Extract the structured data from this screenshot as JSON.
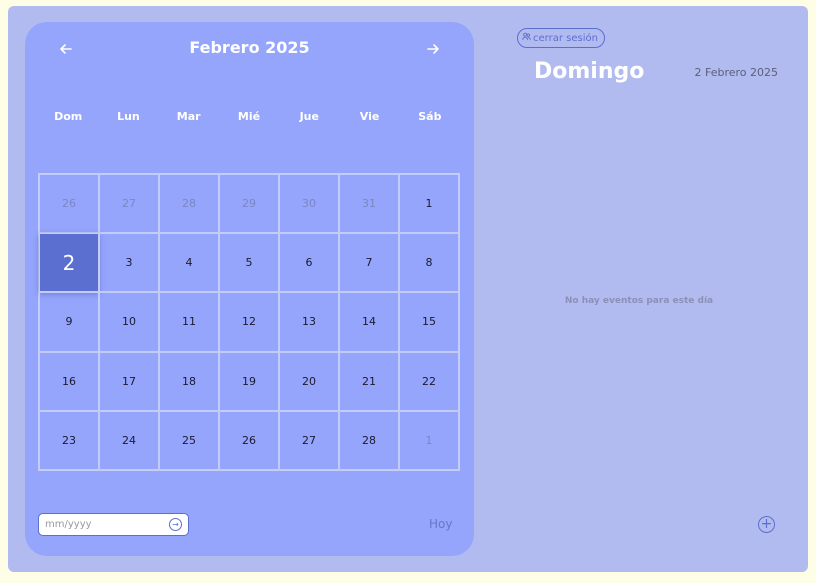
{
  "calendar": {
    "title": "Febrero 2025",
    "prev_icon": "arrow-left-icon",
    "next_icon": "arrow-right-icon",
    "weekdays": [
      "Dom",
      "Lun",
      "Mar",
      "Mié",
      "Jue",
      "Vie",
      "Sáb"
    ],
    "weeks": [
      [
        {
          "d": "26",
          "muted": true
        },
        {
          "d": "27",
          "muted": true
        },
        {
          "d": "28",
          "muted": true
        },
        {
          "d": "29",
          "muted": true
        },
        {
          "d": "30",
          "muted": true
        },
        {
          "d": "31",
          "muted": true
        },
        {
          "d": "1"
        }
      ],
      [
        {
          "d": "2",
          "selected": true
        },
        {
          "d": "3"
        },
        {
          "d": "4"
        },
        {
          "d": "5"
        },
        {
          "d": "6"
        },
        {
          "d": "7"
        },
        {
          "d": "8"
        }
      ],
      [
        {
          "d": "9"
        },
        {
          "d": "10"
        },
        {
          "d": "11"
        },
        {
          "d": "12"
        },
        {
          "d": "13"
        },
        {
          "d": "14"
        },
        {
          "d": "15"
        }
      ],
      [
        {
          "d": "16"
        },
        {
          "d": "17"
        },
        {
          "d": "18"
        },
        {
          "d": "19"
        },
        {
          "d": "20"
        },
        {
          "d": "21"
        },
        {
          "d": "22"
        }
      ],
      [
        {
          "d": "23"
        },
        {
          "d": "24"
        },
        {
          "d": "25"
        },
        {
          "d": "26"
        },
        {
          "d": "27"
        },
        {
          "d": "28"
        },
        {
          "d": "1",
          "muted": true
        }
      ]
    ],
    "date_input": {
      "placeholder": "mm/yyyy",
      "value": ""
    },
    "today_label": "Hoy"
  },
  "side_panel": {
    "logout_label": "cerrar sesión",
    "logout_icon": "users-icon",
    "day_name": "Domingo",
    "full_date": "2 Febrero 2025",
    "empty_message": "No hay eventos para este día",
    "add_icon": "plus-circle-icon"
  },
  "colors": {
    "page_bg": "#fefde6",
    "app_bg": "#b2bbf0",
    "calendar_bg": "#95a5fc",
    "selected_bg": "#5b6fd1",
    "accent": "#5b6fd1"
  }
}
